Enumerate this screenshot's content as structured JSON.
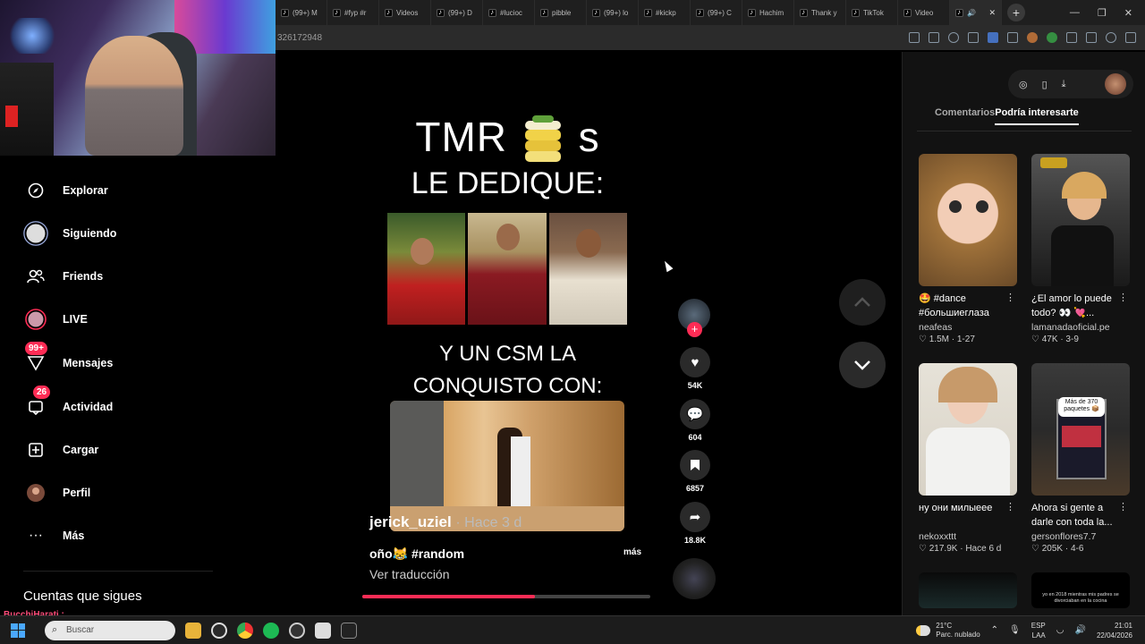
{
  "browser": {
    "tabs": [
      {
        "label": "(99+) M"
      },
      {
        "label": "#fyp #r"
      },
      {
        "label": "Videos"
      },
      {
        "label": "(99+) D"
      },
      {
        "label": "#lucioc"
      },
      {
        "label": "pibble"
      },
      {
        "label": "(99+) lo"
      },
      {
        "label": "#kickp"
      },
      {
        "label": "(99+) C"
      },
      {
        "label": "Hachim"
      },
      {
        "label": "Thank y"
      },
      {
        "label": "TikTok"
      },
      {
        "label": "Video"
      }
    ],
    "url_fragment": "326172948"
  },
  "sidebar": {
    "items": [
      {
        "label": "Explorar",
        "icon": "compass-icon"
      },
      {
        "label": "Siguiendo",
        "icon": "following-avatar-icon"
      },
      {
        "label": "Friends",
        "icon": "friends-icon"
      },
      {
        "label": "LIVE",
        "icon": "live-icon"
      },
      {
        "label": "Mensajes",
        "icon": "messages-icon",
        "badge": "99+"
      },
      {
        "label": "Actividad",
        "icon": "activity-icon",
        "badge": "26"
      },
      {
        "label": "Cargar",
        "icon": "upload-icon"
      },
      {
        "label": "Perfil",
        "icon": "profile-avatar-icon"
      },
      {
        "label": "Más",
        "icon": "more-icon"
      }
    ],
    "following_title": "Cuentas que sigues"
  },
  "video": {
    "title_left": "TMR",
    "title_right": "s",
    "line1": "LE DEDIQUE:",
    "line2a": "Y UN CSM LA",
    "line2b": "CONQUISTO CON:",
    "username": "jerick_uziel",
    "time": "· Hace 3 d",
    "description": "oño😹 #random",
    "more": "más",
    "translate": "Ver traducción",
    "progress": 0.6
  },
  "actions": {
    "likes": "54K",
    "comments": "604",
    "saves": "6857",
    "shares": "18.8K"
  },
  "right_panel": {
    "tabs": [
      "Comentarios",
      "Podría interesarte"
    ],
    "active_tab": "Podría interesarte",
    "cards": [
      {
        "title": "🤩 #dance #большиеглаза",
        "author": "neafeas",
        "stats": "♡ 1.5M · 1-27"
      },
      {
        "title": "¿El amor lo puede todo? 👀 💘...",
        "author": "lamanadaoficial.pe",
        "stats": "♡ 47K · 3-9"
      },
      {
        "title": "ну они милыеее",
        "author": "nekoxxttt",
        "stats": "♡ 217.9K · Hace 6 d"
      },
      {
        "title": "Ahora si gente a darle con toda la...",
        "author": "gersonflores7.7",
        "stats": "♡ 205K · 4-6"
      }
    ],
    "thumb_text_4": "Más de 370 paquetes 📦",
    "thumb_text_6": "yo en 2018 mientras mis padres se divorciaban en la cocina"
  },
  "stream_overlay": "BucchiHarati :",
  "taskbar": {
    "search_placeholder": "Buscar",
    "weather_temp": "21°C",
    "weather_desc": "Parc. nublado",
    "lang": "ESP",
    "lang_sub": "LAA",
    "time": "21:01",
    "date": "22/04/2026"
  },
  "colors": {
    "accent": "#fe2c55",
    "background": "#000000",
    "panel": "#121212"
  }
}
